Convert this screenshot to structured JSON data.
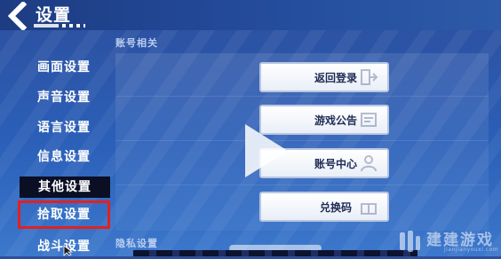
{
  "header": {
    "back_icon": "chevron-left-icon",
    "title": "设置"
  },
  "sidebar": {
    "items": [
      {
        "label": "画面设置",
        "active": false
      },
      {
        "label": "声音设置",
        "active": false
      },
      {
        "label": "语言设置",
        "active": false
      },
      {
        "label": "信息设置",
        "active": false
      },
      {
        "label": "其他设置",
        "active": true
      },
      {
        "label": "拾取设置",
        "active": false,
        "highlighted": true
      },
      {
        "label": "战斗设置",
        "active": false
      }
    ]
  },
  "main": {
    "section_account": "账号相关",
    "account_buttons": [
      {
        "label": "返回登录",
        "icon": "logout-icon"
      },
      {
        "label": "游戏公告",
        "icon": "notice-icon"
      },
      {
        "label": "账号中心",
        "icon": "user-icon"
      },
      {
        "label": "兑换码",
        "icon": "gift-icon"
      }
    ],
    "section_privacy": "隐私设置"
  },
  "overlay": {
    "play_icon": "play-icon",
    "watermark_text": "建建游戏",
    "watermark_url": "jianjianyouxi.com"
  },
  "colors": {
    "background": "#2b5fb8",
    "active_tab": "#0a0f24",
    "highlight_border": "#e32020",
    "button_text": "#1e2c55"
  }
}
